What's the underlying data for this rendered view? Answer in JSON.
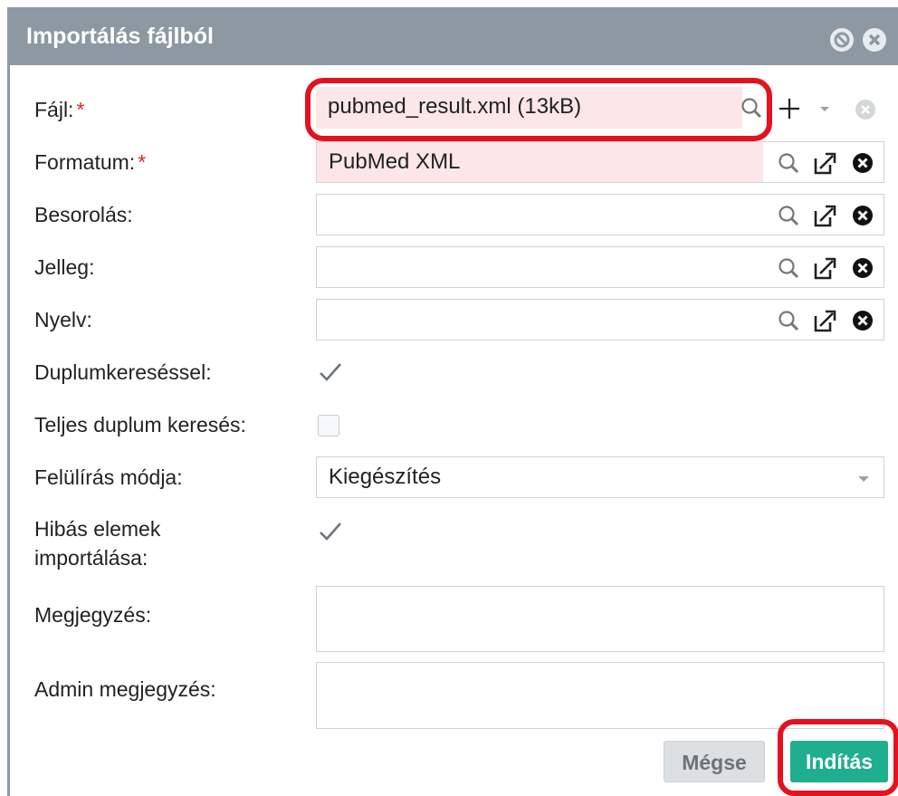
{
  "dialog": {
    "title": "Importálás fájlból"
  },
  "form": {
    "file": {
      "label": "Fájl:",
      "value": "pubmed_result.xml (13kB)"
    },
    "format": {
      "label": "Formatum:",
      "value": "PubMed XML"
    },
    "classification": {
      "label": "Besorolás:",
      "value": ""
    },
    "type": {
      "label": "Jelleg:",
      "value": ""
    },
    "language": {
      "label": "Nyelv:",
      "value": ""
    },
    "duplicate_search": {
      "label": "Duplumkereséssel:",
      "checked": true
    },
    "full_duplicate_search": {
      "label": "Teljes duplum keresés:",
      "checked": false
    },
    "overwrite_mode": {
      "label": "Felülírás módja:",
      "value": "Kiegészítés"
    },
    "import_faulty_line1": "Hibás elemek",
    "import_faulty_line2": "importálása:",
    "import_faulty_checked": true,
    "note": {
      "label": "Megjegyzés:",
      "value": ""
    },
    "admin_note": {
      "label": "Admin megjegyzés:",
      "value": ""
    }
  },
  "required_marker": "*",
  "buttons": {
    "cancel": "Mégse",
    "start": "Indítás"
  },
  "colors": {
    "titlebar": "#8e98a2",
    "required_bg": "#fce6e8",
    "primary_button": "#1fae8e",
    "highlight": "#e4121f"
  }
}
